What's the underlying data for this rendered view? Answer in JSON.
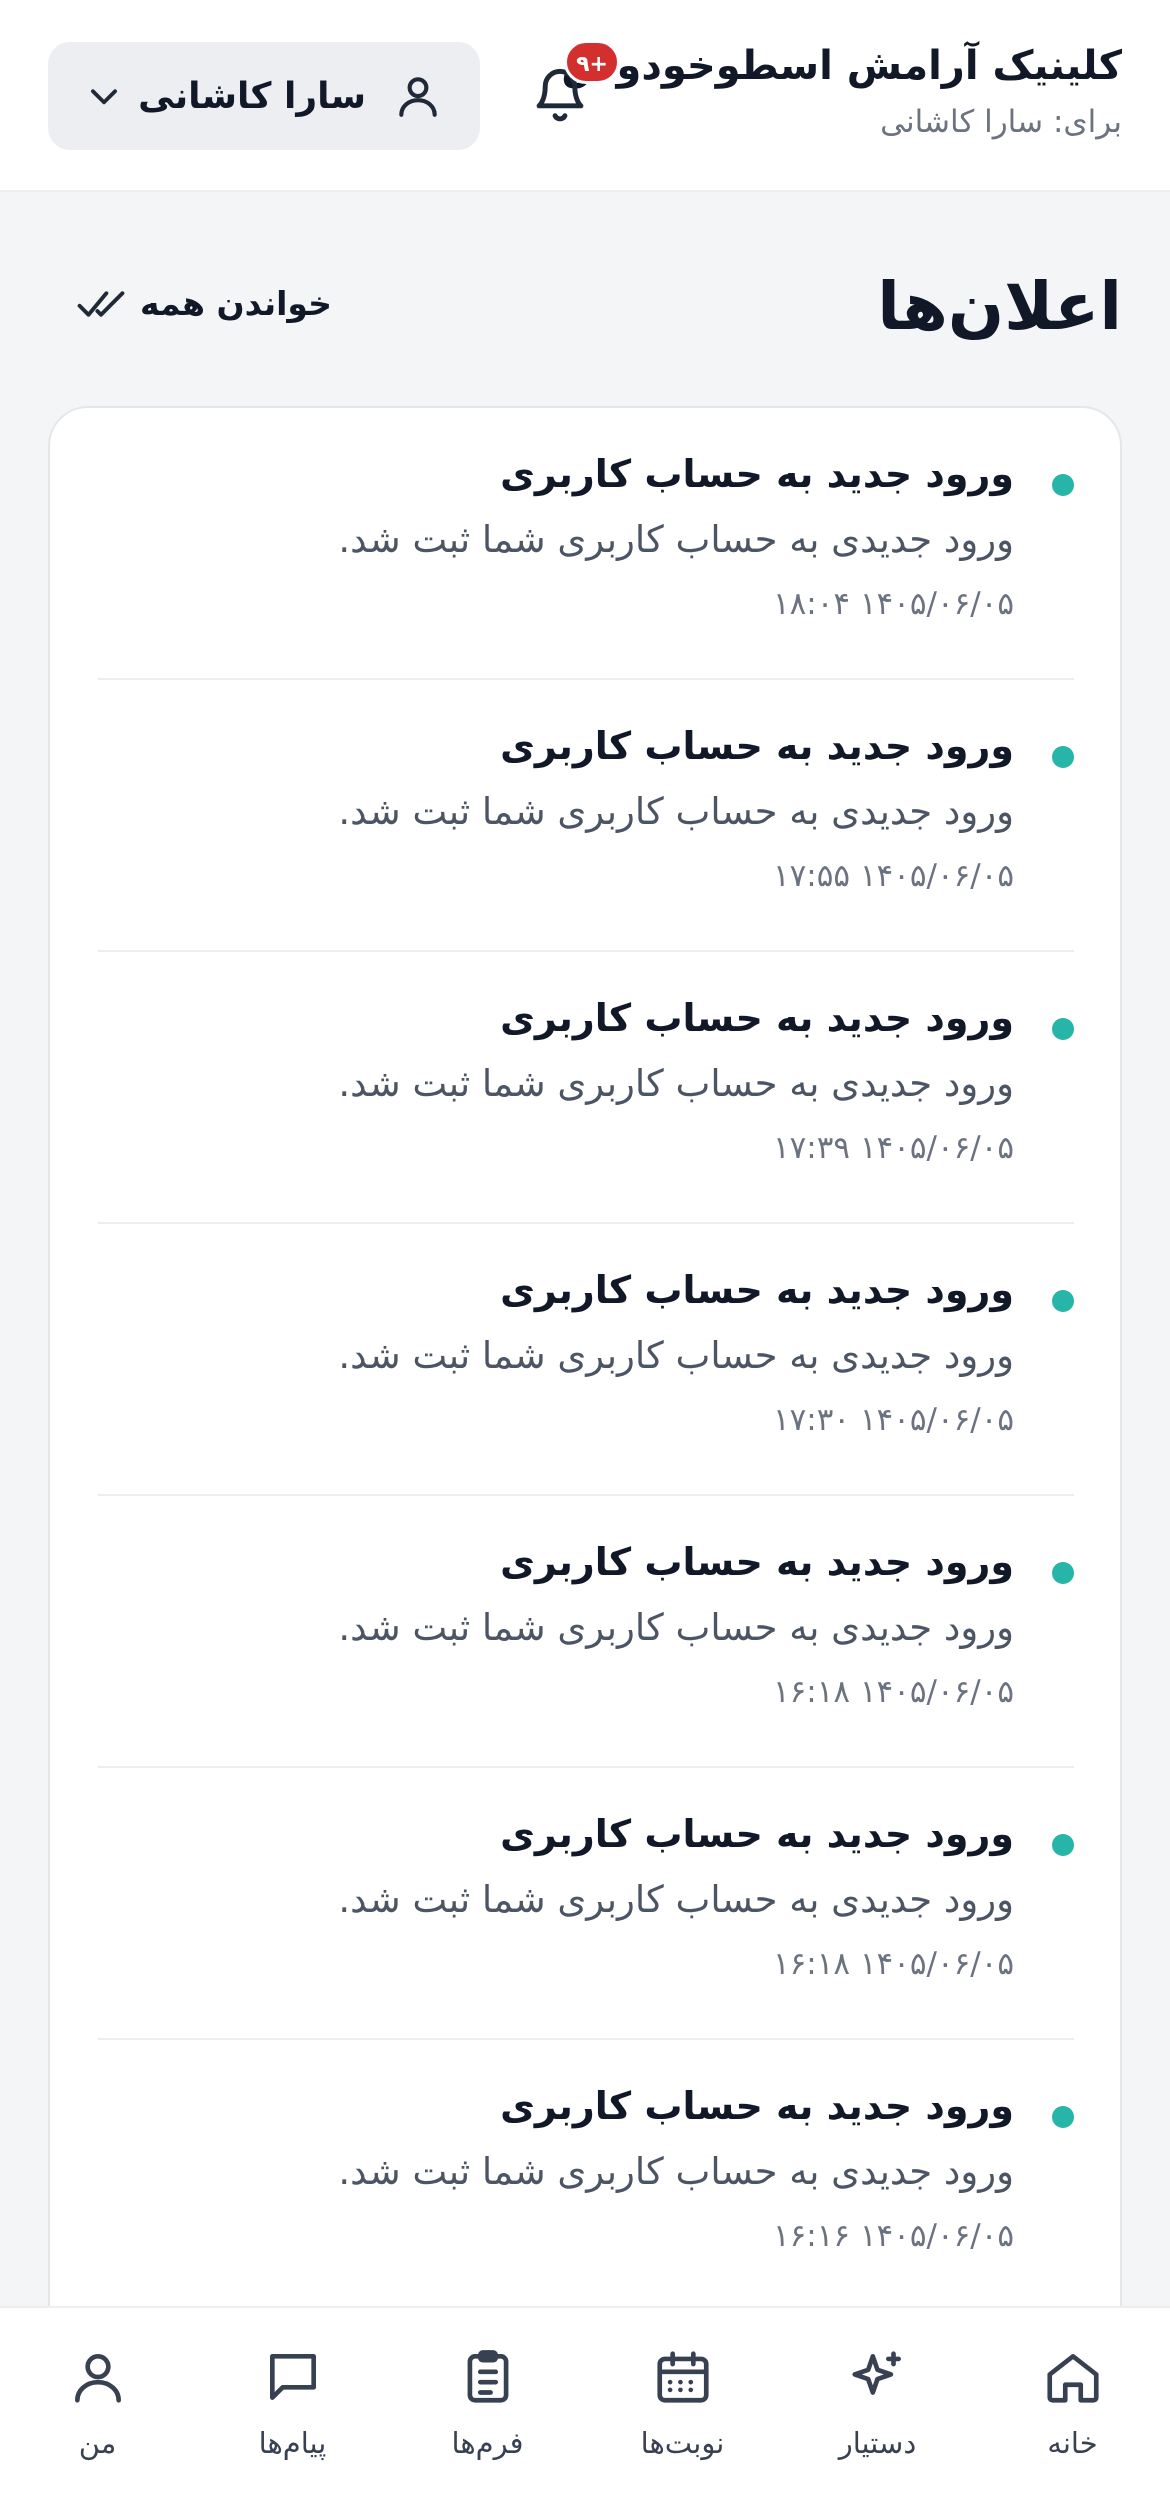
{
  "header": {
    "clinic_name": "کلینیک آرامش اسطوخودوس",
    "for_user": "برای: سارا کاشانی",
    "notification_badge": "۹+",
    "user_name": "سارا کاشانی"
  },
  "page": {
    "title": "اعلان‌ها",
    "mark_all_read": "خواندن همه"
  },
  "notifications": [
    {
      "title": "ورود جدید به حساب کاربری",
      "body": "ورود جدیدی به حساب کاربری شما ثبت شد.",
      "time": "۱۴۰۵/۰۶/۰۵ ۱۸:۰۴"
    },
    {
      "title": "ورود جدید به حساب کاربری",
      "body": "ورود جدیدی به حساب کاربری شما ثبت شد.",
      "time": "۱۴۰۵/۰۶/۰۵ ۱۷:۵۵"
    },
    {
      "title": "ورود جدید به حساب کاربری",
      "body": "ورود جدیدی به حساب کاربری شما ثبت شد.",
      "time": "۱۴۰۵/۰۶/۰۵ ۱۷:۳۹"
    },
    {
      "title": "ورود جدید به حساب کاربری",
      "body": "ورود جدیدی به حساب کاربری شما ثبت شد.",
      "time": "۱۴۰۵/۰۶/۰۵ ۱۷:۳۰"
    },
    {
      "title": "ورود جدید به حساب کاربری",
      "body": "ورود جدیدی به حساب کاربری شما ثبت شد.",
      "time": "۱۴۰۵/۰۶/۰۵ ۱۶:۱۸"
    },
    {
      "title": "ورود جدید به حساب کاربری",
      "body": "ورود جدیدی به حساب کاربری شما ثبت شد.",
      "time": "۱۴۰۵/۰۶/۰۵ ۱۶:۱۸"
    },
    {
      "title": "ورود جدید به حساب کاربری",
      "body": "ورود جدیدی به حساب کاربری شما ثبت شد.",
      "time": "۱۴۰۵/۰۶/۰۵ ۱۶:۱۶"
    }
  ],
  "nav": {
    "home": "خانه",
    "assistant": "دستیار",
    "appointments": "نوبت‌ها",
    "forms": "فرم‌ها",
    "messages": "پیام‌ها",
    "me": "من"
  },
  "colors": {
    "unread_dot": "#26b5a6",
    "badge": "#d32f2f",
    "page_bg": "#f4f5f7"
  },
  "icons": [
    "bell-icon",
    "user-icon",
    "chevron-down-icon",
    "double-check-icon",
    "home-icon",
    "sparkle-icon",
    "calendar-icon",
    "clipboard-icon",
    "message-icon",
    "person-icon"
  ]
}
